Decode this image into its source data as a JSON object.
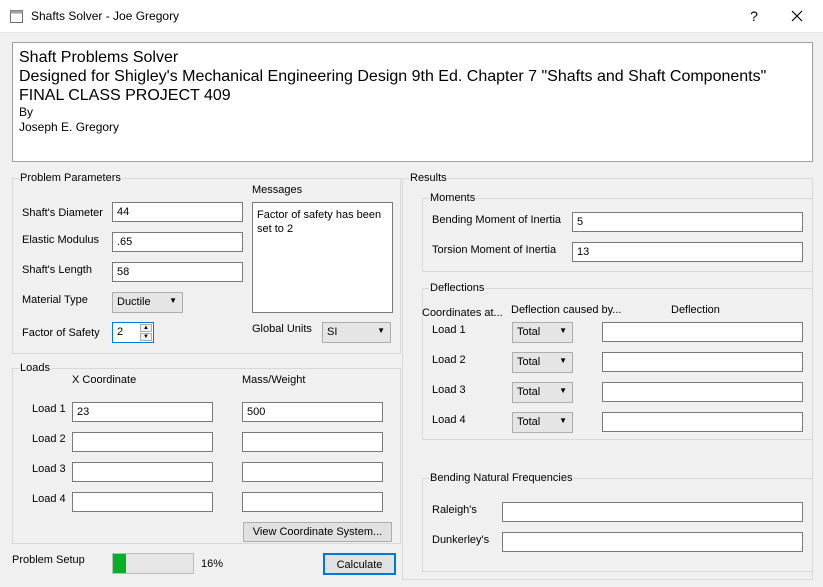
{
  "window": {
    "title": "Shafts Solver - Joe Gregory",
    "help_label": "?",
    "close_label": "✕"
  },
  "header": {
    "line1": "Shaft Problems Solver",
    "line2": "Designed for Shigley's Mechanical Engineering Design 9th Ed. Chapter 7 \"Shafts and Shaft Components\"",
    "line3": "FINAL CLASS PROJECT 409",
    "line4": "By",
    "line5": "Joseph E. Gregory"
  },
  "params": {
    "group_title": "Problem Parameters",
    "diameter_label": "Shaft's Diameter",
    "diameter_value": "44",
    "elastic_label": "Elastic Modulus",
    "elastic_value": ".65",
    "length_label": "Shaft's Length",
    "length_value": "58",
    "material_label": "Material Type",
    "material_value": "Ductile",
    "fos_label": "Factor of Safety",
    "fos_value": "2",
    "messages_label": "Messages",
    "messages_text": "Factor of safety has been set to 2",
    "units_label": "Global Units",
    "units_value": "SI"
  },
  "loads": {
    "group_title": "Loads",
    "x_header": "X Coordinate",
    "mass_header": "Mass/Weight",
    "rows": [
      {
        "label": "Load 1",
        "x": "23",
        "mass": "500"
      },
      {
        "label": "Load 2",
        "x": "",
        "mass": ""
      },
      {
        "label": "Load 3",
        "x": "",
        "mass": ""
      },
      {
        "label": "Load 4",
        "x": "",
        "mass": ""
      }
    ],
    "view_button": "View Coordinate System..."
  },
  "footer": {
    "setup_label": "Problem Setup",
    "progress_percent": 16,
    "progress_text": "16%",
    "calculate_button": "Calculate"
  },
  "results": {
    "group_title": "Results",
    "moments_title": "Moments",
    "bending_label": "Bending Moment of Inertia",
    "bending_value": "5",
    "torsion_label": "Torsion Moment of Inertia",
    "torsion_value": "13",
    "deflections_title": "Deflections",
    "coords_header": "Coordinates at...",
    "caused_header": "Deflection caused by...",
    "deflection_header": "Deflection",
    "rows": [
      {
        "label": "Load 1",
        "cause": "Total",
        "value": ""
      },
      {
        "label": "Load 2",
        "cause": "Total",
        "value": ""
      },
      {
        "label": "Load 3",
        "cause": "Total",
        "value": ""
      },
      {
        "label": "Load 4",
        "cause": "Total",
        "value": ""
      }
    ],
    "freq_title": "Bending Natural Frequencies",
    "raleigh_label": "Raleigh's",
    "raleigh_value": "",
    "dunkerley_label": "Dunkerley's",
    "dunkerley_value": ""
  },
  "colors": {
    "progress": "#06b025",
    "focus_border": "#0078d7"
  }
}
